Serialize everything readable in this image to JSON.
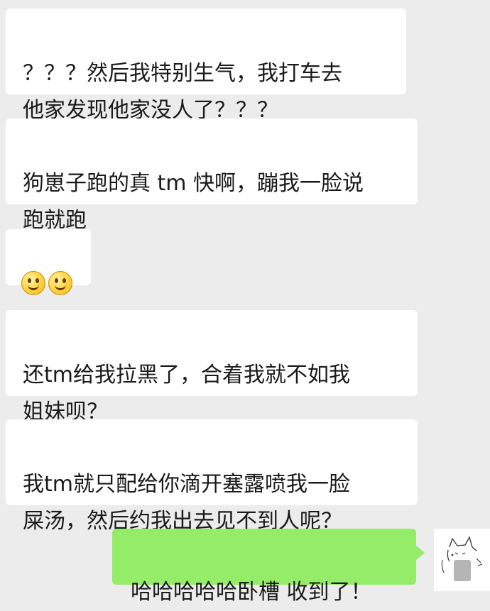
{
  "messages": [
    {
      "text": "？？？然后我特别生气，我打车去\n他家发现他家没人了？？？"
    },
    {
      "text": "狗崽子跑的真 tm 快啊，蹦我一脸说\n跑就跑"
    },
    {
      "emoji": [
        "smile-emoji",
        "smile-emoji"
      ]
    },
    {
      "text": "还tm给我拉黑了，合着我就不如我\n姐妹呗？"
    },
    {
      "text": "我tm就只配给你滴开塞露喷我一脸\n屎汤，然后约我出去见不到人呢？"
    },
    {
      "text": "哈哈哈哈哈卧槽 收到了！"
    }
  ],
  "colors": {
    "background": "#ececec",
    "incoming_bubble": "#ffffff",
    "outgoing_bubble": "#95ec69"
  }
}
